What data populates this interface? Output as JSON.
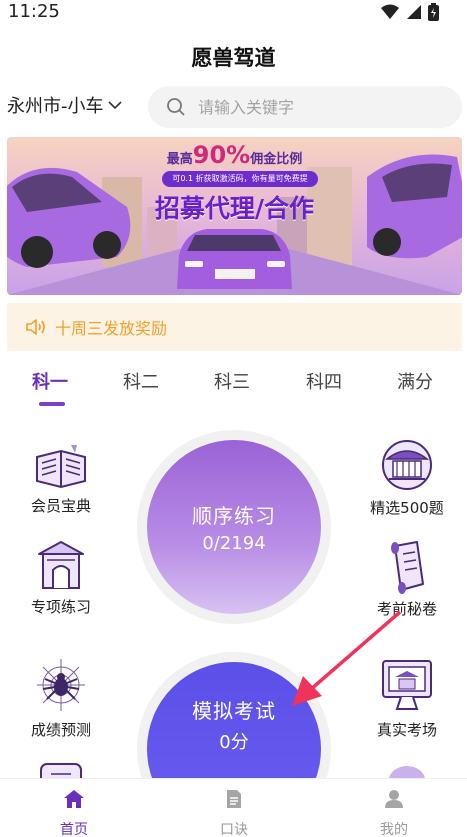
{
  "status": {
    "time": "11:25"
  },
  "header": {
    "title": "愿兽驾道"
  },
  "location": {
    "label": "永州市-小车"
  },
  "search": {
    "placeholder": "请输入关键字"
  },
  "banner": {
    "line1_prefix": "最高",
    "line1_big": "90%",
    "line1_suffix": "佣金比例",
    "line2": "可0.1 折获取激活码，你有量可免费提",
    "line3": "招募代理/合作"
  },
  "notice": {
    "text": "十周三发放奖励"
  },
  "tabs": [
    {
      "label": "科一"
    },
    {
      "label": "科二"
    },
    {
      "label": "科三"
    },
    {
      "label": "科四"
    },
    {
      "label": "满分"
    }
  ],
  "features": {
    "left": [
      {
        "label": "会员宝典",
        "icon": "book-icon"
      },
      {
        "label": "专项练习",
        "icon": "gate-icon"
      },
      {
        "label": "成绩预测",
        "icon": "spider-icon"
      }
    ],
    "right": [
      {
        "label": "精选500题",
        "icon": "pavilion-icon"
      },
      {
        "label": "考前秘卷",
        "icon": "scroll-icon"
      },
      {
        "label": "真实考场",
        "icon": "monitor-icon"
      }
    ]
  },
  "circles": {
    "practice": {
      "title": "顺序练习",
      "value": "0/2194"
    },
    "exam": {
      "title": "模拟考试",
      "value": "0分"
    }
  },
  "bottom_nav": [
    {
      "label": "首页",
      "icon": "home-icon",
      "active": true
    },
    {
      "label": "口诀",
      "icon": "document-icon",
      "active": false
    },
    {
      "label": "我的",
      "icon": "user-icon",
      "active": false
    }
  ],
  "colors": {
    "accent": "#6b2fbf",
    "notice": "#f0a12a"
  }
}
